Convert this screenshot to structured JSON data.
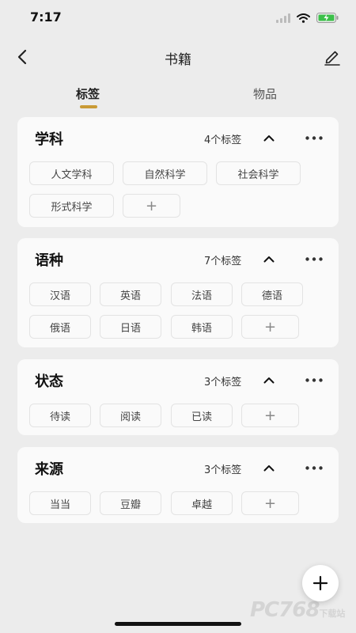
{
  "status_bar": {
    "time": "7:17",
    "icons": [
      "signal-icon",
      "wifi-icon",
      "battery-charging-icon"
    ]
  },
  "nav": {
    "title": "书籍",
    "back_icon": "chevron-left-icon",
    "edit_icon": "pencil-icon"
  },
  "tabs": [
    {
      "label": "标签",
      "active": true
    },
    {
      "label": "物品",
      "active": false
    }
  ],
  "accent_color": "#c99a35",
  "groups": [
    {
      "title": "学科",
      "count": "4个标签",
      "tags": [
        "人文学科",
        "自然科学",
        "社会科学",
        "形式科学"
      ]
    },
    {
      "title": "语种",
      "count": "7个标签",
      "tags": [
        "汉语",
        "英语",
        "法语",
        "德语",
        "俄语",
        "日语",
        "韩语"
      ]
    },
    {
      "title": "状态",
      "count": "3个标签",
      "tags": [
        "待读",
        "阅读",
        "已读"
      ]
    },
    {
      "title": "来源",
      "count": "3个标签",
      "tags": [
        "当当",
        "豆瓣",
        "卓越"
      ]
    }
  ],
  "add_tag_label": "+",
  "fab": {
    "icon": "plus-icon"
  },
  "watermark": {
    "text": "PC768",
    "suffix": "下载站"
  }
}
